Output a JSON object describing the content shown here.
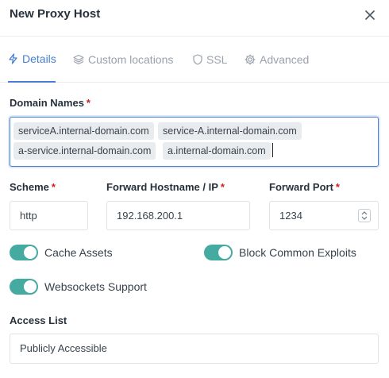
{
  "dialog": {
    "title": "New Proxy Host",
    "close_icon": "close-icon"
  },
  "tabs": [
    {
      "label": "Details",
      "icon": "lightning-icon",
      "active": true
    },
    {
      "label": "Custom locations",
      "icon": "layers-icon",
      "active": false
    },
    {
      "label": "SSL",
      "icon": "shield-icon",
      "active": false
    },
    {
      "label": "Advanced",
      "icon": "gear-icon",
      "active": false
    }
  ],
  "form": {
    "domain_names": {
      "label": "Domain Names",
      "required_mark": "*",
      "values": [
        "serviceA.internal-domain.com",
        "service-A.internal-domain.com",
        "a-service.internal-domain.com",
        "a.internal-domain.com"
      ]
    },
    "scheme": {
      "label": "Scheme",
      "required_mark": "*",
      "value": "http"
    },
    "forward_hostname": {
      "label": "Forward Hostname / IP",
      "required_mark": "*",
      "value": "192.168.200.1"
    },
    "forward_port": {
      "label": "Forward Port",
      "required_mark": "*",
      "value": "1234"
    },
    "toggles": [
      {
        "label": "Cache Assets",
        "on": true
      },
      {
        "label": "Block Common Exploits",
        "on": true
      },
      {
        "label": "Websockets Support",
        "on": true
      }
    ],
    "access_list": {
      "label": "Access List",
      "value": "Publicly Accessible"
    }
  },
  "colors": {
    "accent": "#467fcf",
    "toggle_on": "#45aaa0",
    "required": "#cd201f"
  }
}
